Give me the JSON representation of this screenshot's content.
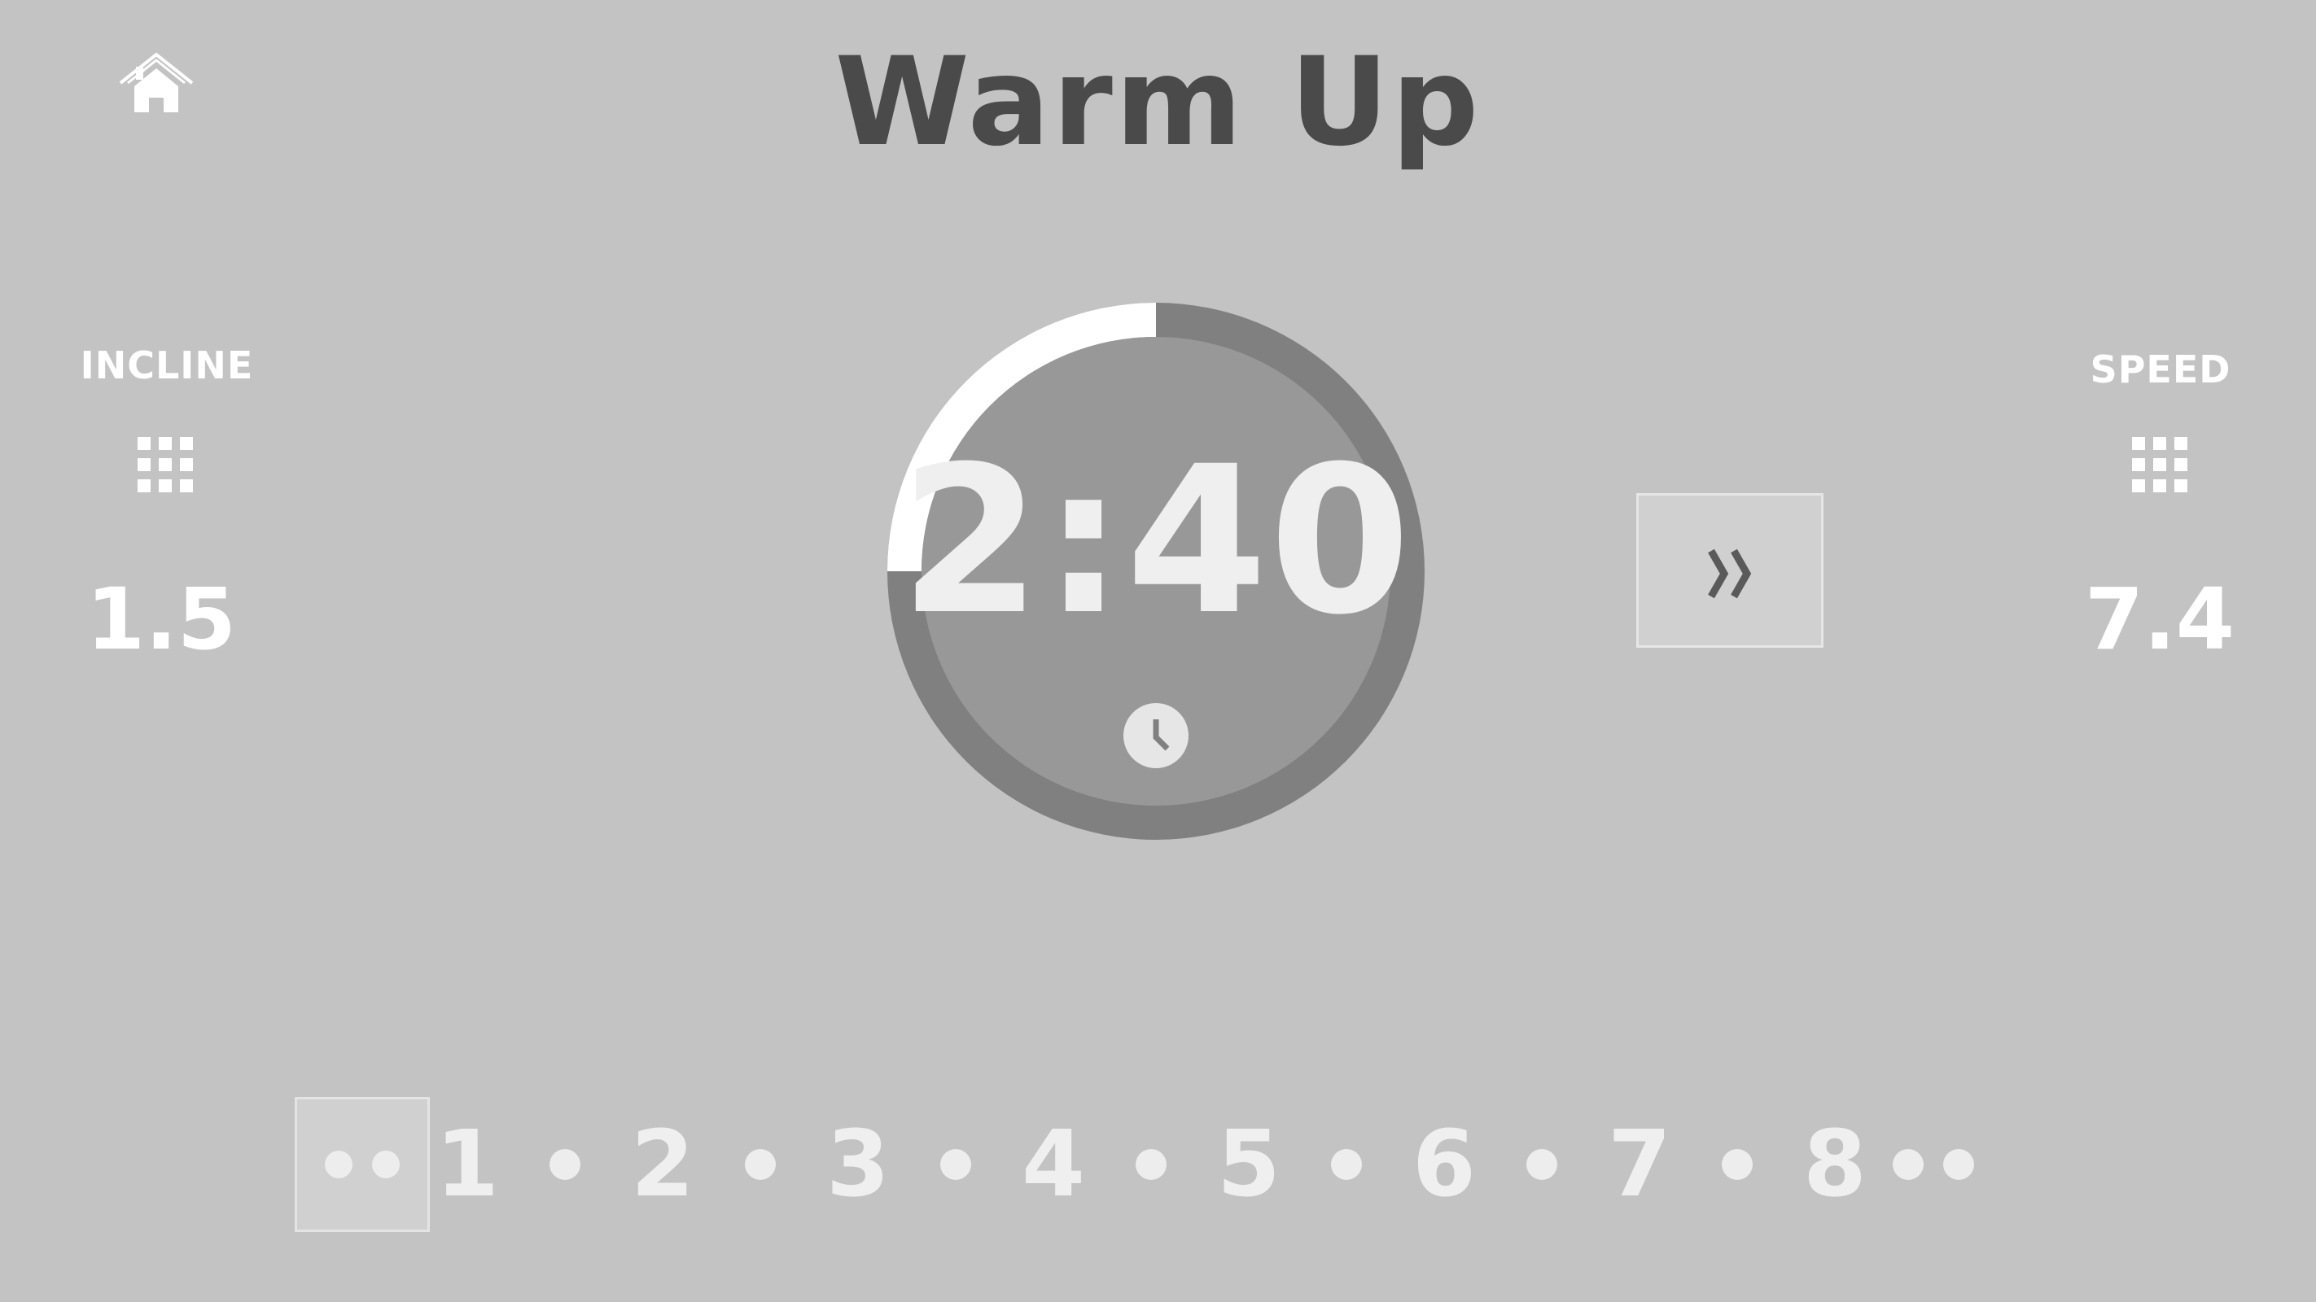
{
  "header": {
    "title": "Warm Up",
    "home_icon": "home-icon"
  },
  "incline": {
    "label": "INCLINE",
    "value": "1.5",
    "keypad_icon": "keypad-icon"
  },
  "speed": {
    "label": "SPEED",
    "value": "7.4",
    "keypad_icon": "keypad-icon"
  },
  "timer": {
    "time": "2:40",
    "progress_fraction": 0.25,
    "clock_icon": "clock-icon"
  },
  "skip_button": {
    "icon": "double-chevron-right-icon"
  },
  "intervals": {
    "labels": [
      "1",
      "2",
      "3",
      "4",
      "5",
      "6",
      "7",
      "8"
    ]
  },
  "colors": {
    "background": "#c3c3c3",
    "title": "#4a4a4a",
    "ring_track": "#808080",
    "ring_progress": "#ffffff",
    "dial_face": "#989898",
    "text_light": "#efefef"
  }
}
